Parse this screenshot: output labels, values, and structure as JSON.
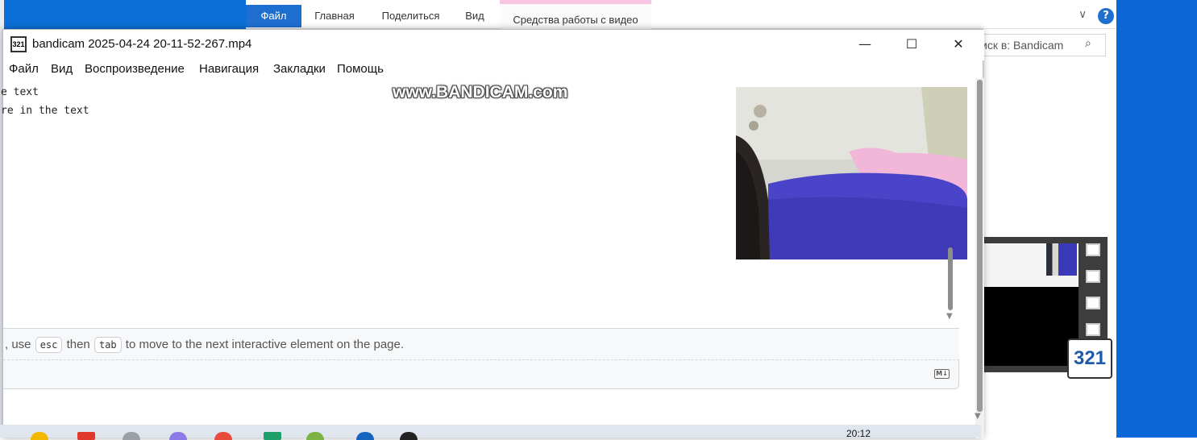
{
  "explorer": {
    "ribbon_tabs": [
      "Файл",
      "Главная",
      "Поделиться",
      "Вид",
      "Средства работы с видео"
    ],
    "search_placeholder": "иск в: Bandicam",
    "help_label": "?",
    "chevron": "∨"
  },
  "player": {
    "title": "bandicam 2025-04-24 20-11-52-267.mp4",
    "app_icon_text": "321",
    "window_controls": {
      "minimize": "—",
      "maximize": "☐",
      "close": "✕"
    },
    "menu": [
      "Файл",
      "Вид",
      "Воспроизведение",
      "Навигация",
      "Закладки",
      "Помощь"
    ],
    "video": {
      "code_lines": [
        "e text",
        "re in the text"
      ],
      "watermark": "www.BANDICAM.com",
      "hint": {
        "prefix": ", use",
        "key1": "esc",
        "middle": "then",
        "key2": "tab",
        "suffix": "to move to the next interactive element on the page."
      },
      "markdown_icon": "M↓"
    }
  },
  "thumbnail": {
    "badge": "321"
  },
  "taskbar": {
    "clock": "20:12"
  },
  "colors": {
    "ribbon_blue": "#1f6fd0",
    "desktop_blue": "#0b67d8",
    "video_tab_accent": "#f7c4e4"
  }
}
